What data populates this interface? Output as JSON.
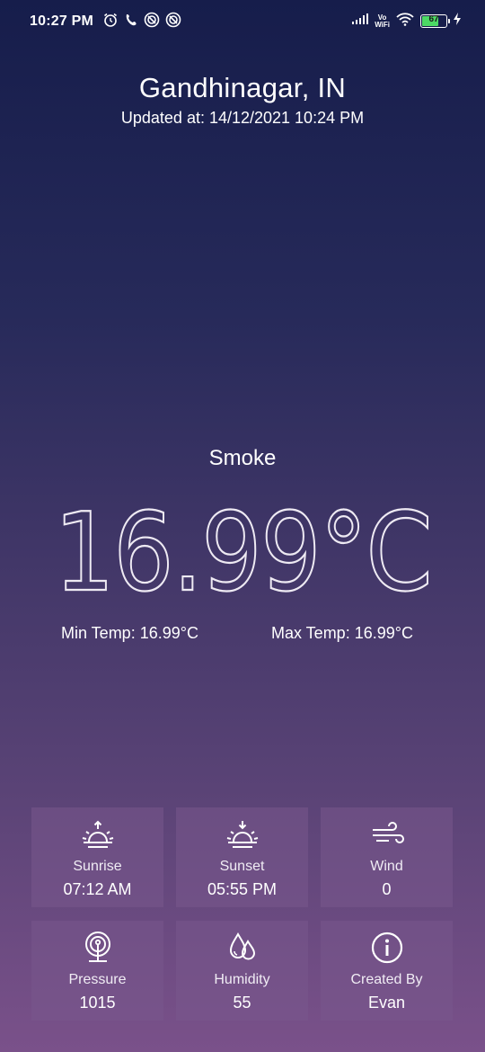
{
  "status_bar": {
    "time": "10:27 PM",
    "battery_level": "67",
    "wifi_label_top": "Vo",
    "wifi_label_bottom": "WiFi",
    "icons": [
      "alarm-icon",
      "call-icon",
      "hotspot-icon",
      "hotspot-icon",
      "signal-icon",
      "vowifi-icon",
      "wifi-icon",
      "battery-icon",
      "charging-icon"
    ]
  },
  "header": {
    "title": "Gandhinagar, IN",
    "updated": "Updated at: 14/12/2021 10:24 PM"
  },
  "main": {
    "condition": "Smoke",
    "temperature": "16.99°C",
    "min_temp": "Min Temp: 16.99°C",
    "max_temp": "Max Temp: 16.99°C"
  },
  "details": [
    {
      "icon": "sunrise-icon",
      "label": "Sunrise",
      "value": "07:12 AM"
    },
    {
      "icon": "sunset-icon",
      "label": "Sunset",
      "value": "05:55 PM"
    },
    {
      "icon": "wind-icon",
      "label": "Wind",
      "value": "0"
    },
    {
      "icon": "pressure-icon",
      "label": "Pressure",
      "value": "1015"
    },
    {
      "icon": "humidity-icon",
      "label": "Humidity",
      "value": "55"
    },
    {
      "icon": "info-icon",
      "label": "Created By",
      "value": "Evan"
    }
  ],
  "colors": {
    "background_top": "#161d4b",
    "background_bottom": "#7a518a",
    "card": "#6b4f80",
    "battery_fill": "#4cd964"
  }
}
